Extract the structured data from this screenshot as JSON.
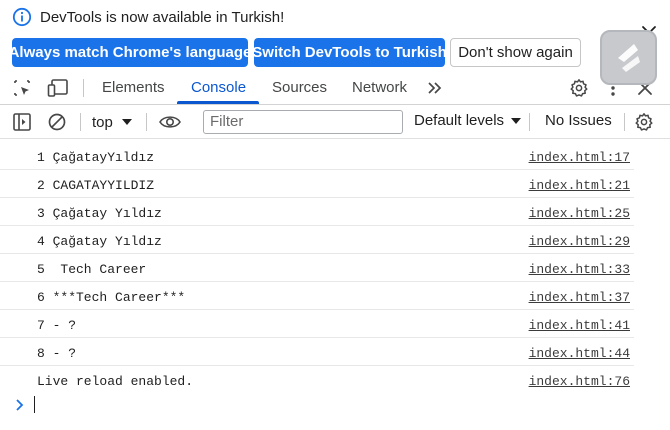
{
  "infobar": {
    "message": "DevTools is now available in Turkish!",
    "buttons": {
      "match_language": "Always match Chrome's language",
      "switch_language": "Switch DevTools to Turkish",
      "dont_show": "Don't show again"
    }
  },
  "toolbar": {
    "tabs": [
      {
        "label": "Elements",
        "active": false
      },
      {
        "label": "Console",
        "active": true
      },
      {
        "label": "Sources",
        "active": false
      },
      {
        "label": "Network",
        "active": false
      }
    ],
    "more_tabs": "»"
  },
  "console_toolbar": {
    "context": "top",
    "filter_placeholder": "Filter",
    "levels": "Default levels",
    "issues": "No Issues"
  },
  "messages": [
    {
      "text": "1 ÇağatayYıldız",
      "source": "index.html:17"
    },
    {
      "text": "2 CAGATAYYILDIZ",
      "source": "index.html:21"
    },
    {
      "text": "3 Çağatay Yıldız",
      "source": "index.html:25"
    },
    {
      "text": "4 Çağatay Yıldız",
      "source": "index.html:29"
    },
    {
      "text": "5  Tech Career",
      "source": "index.html:33"
    },
    {
      "text": "6 ***Tech Career***",
      "source": "index.html:37"
    },
    {
      "text": "7 - ?",
      "source": "index.html:41"
    },
    {
      "text": "8 - ?",
      "source": "index.html:44"
    },
    {
      "text": "Live reload enabled.",
      "source": "index.html:76"
    }
  ],
  "colors": {
    "accent": "#0b57d0",
    "button_blue": "#1a73e8",
    "icon_gray": "#474747"
  },
  "icons": {
    "info": "info-icon",
    "close": "close-icon",
    "inspect": "inspect-element-icon",
    "device": "device-toolbar-icon",
    "settings": "gear-icon",
    "menu": "kebab-menu-icon",
    "sidebar": "sidebar-toggle-icon",
    "clear": "clear-console-icon",
    "eye": "live-expression-icon",
    "prompt": "chevron-right-icon"
  }
}
